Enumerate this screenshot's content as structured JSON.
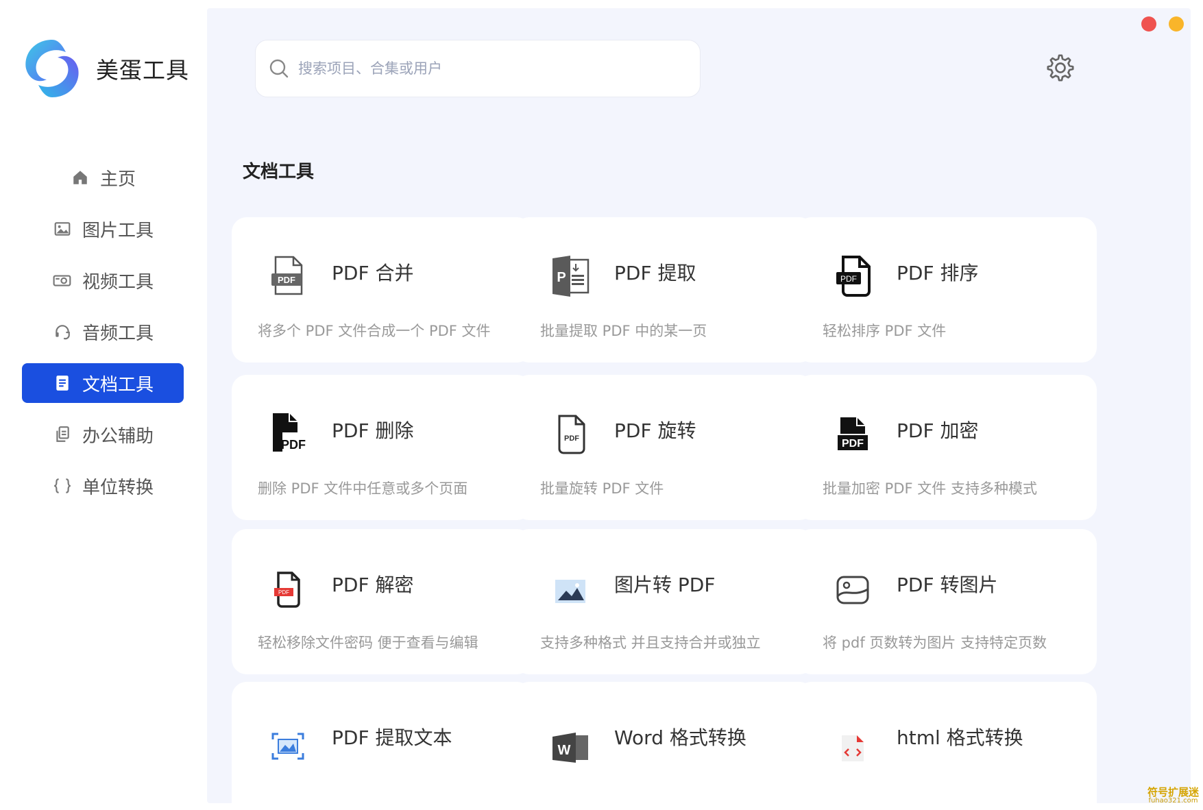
{
  "app": {
    "brand_name": "美蛋工具",
    "brand_colors": {
      "primary": "#1a4fe0",
      "logo_a": "#5b6cf5",
      "logo_b": "#3ec7e6"
    }
  },
  "sidebar": {
    "items": [
      {
        "label": "主页",
        "icon": "home-icon",
        "active": false
      },
      {
        "label": "图片工具",
        "icon": "image-icon",
        "active": false
      },
      {
        "label": "视频工具",
        "icon": "video-icon",
        "active": false
      },
      {
        "label": "音频工具",
        "icon": "headphones-icon",
        "active": false
      },
      {
        "label": "文档工具",
        "icon": "document-icon",
        "active": true
      },
      {
        "label": "办公辅助",
        "icon": "copy-icon",
        "active": false
      },
      {
        "label": "单位转换",
        "icon": "braces-icon",
        "active": false
      }
    ]
  },
  "window": {
    "close_color": "#ef5350",
    "minimize_color": "#f9b52a"
  },
  "search": {
    "placeholder": "搜索项目、合集或用户",
    "value": ""
  },
  "main": {
    "section_title": "文档工具",
    "cards": [
      {
        "title": "PDF 合并",
        "desc": "将多个 PDF 文件合成一个 PDF 文件",
        "icon": "pdf-merge-icon"
      },
      {
        "title": "PDF 提取",
        "desc": "批量提取 PDF 中的某一页",
        "icon": "pdf-extract-icon"
      },
      {
        "title": "PDF 排序",
        "desc": "轻松排序 PDF 文件",
        "icon": "pdf-sort-icon"
      },
      {
        "title": "PDF 删除",
        "desc": "删除 PDF 文件中任意或多个页面",
        "icon": "pdf-delete-icon"
      },
      {
        "title": "PDF 旋转",
        "desc": "批量旋转 PDF 文件",
        "icon": "pdf-rotate-icon"
      },
      {
        "title": "PDF 加密",
        "desc": "批量加密 PDF 文件 支持多种模式",
        "icon": "pdf-encrypt-icon"
      },
      {
        "title": "PDF 解密",
        "desc": "轻松移除文件密码 便于查看与编辑",
        "icon": "pdf-decrypt-icon"
      },
      {
        "title": "图片转 PDF",
        "desc": "支持多种格式 并且支持合并或独立",
        "icon": "image-to-pdf-icon"
      },
      {
        "title": "PDF 转图片",
        "desc": "将 pdf 页数转为图片 支持特定页数",
        "icon": "pdf-to-image-icon"
      },
      {
        "title": "PDF 提取文本",
        "desc": "",
        "icon": "pdf-text-extract-icon"
      },
      {
        "title": "Word 格式转换",
        "desc": "",
        "icon": "word-convert-icon"
      },
      {
        "title": "html 格式转换",
        "desc": "",
        "icon": "html-convert-icon"
      }
    ]
  },
  "watermark": {
    "line1": "符号扩展迷",
    "line2": "fuhao321.com"
  }
}
